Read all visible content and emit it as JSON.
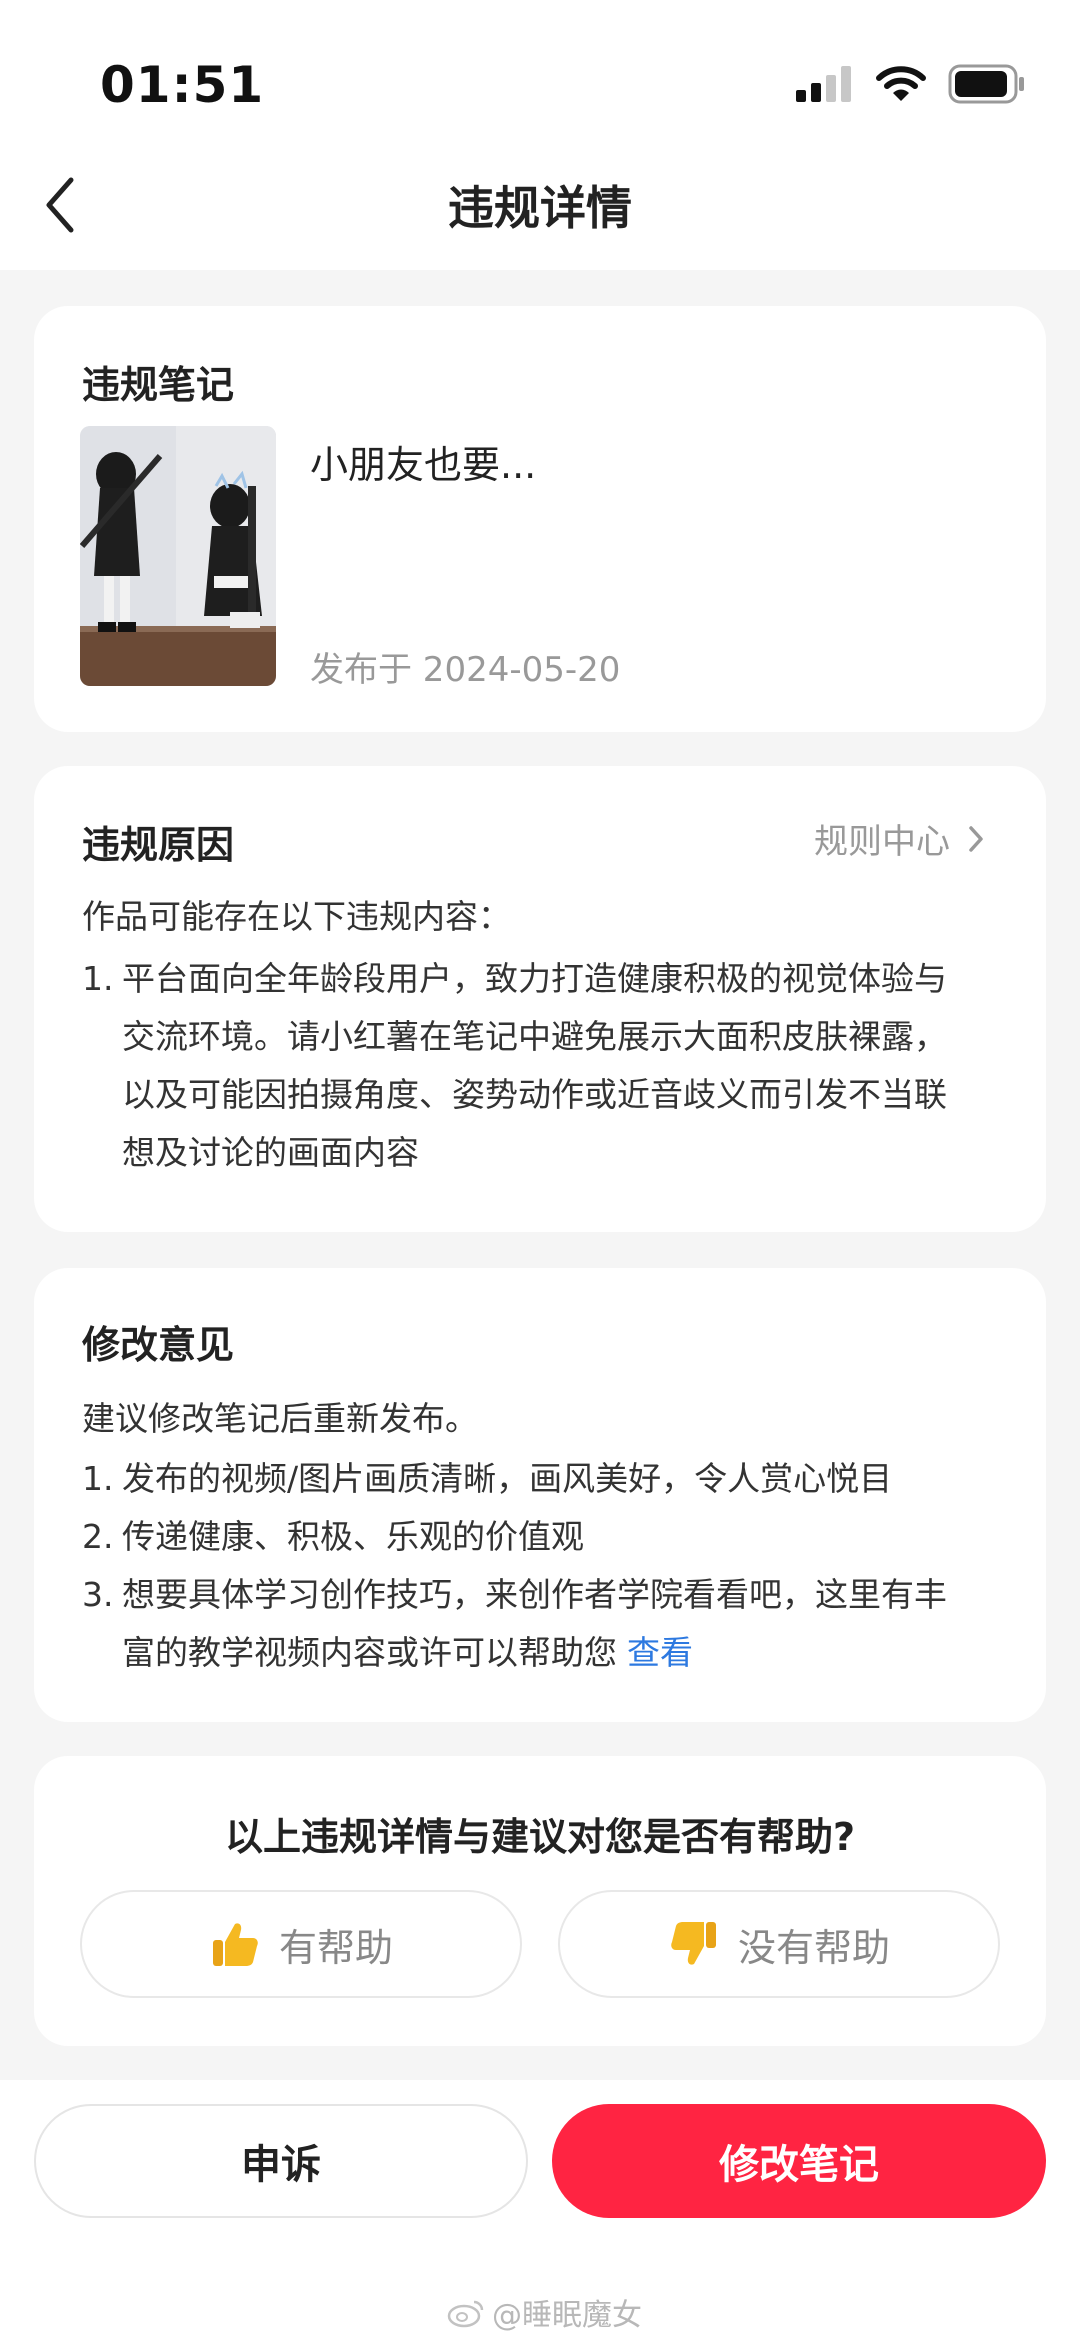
{
  "status_bar": {
    "time": "01:51"
  },
  "nav": {
    "title": "违规详情"
  },
  "note_card": {
    "title": "违规笔记",
    "note_title": "小朋友也要...",
    "date": "发布于 2024-05-20"
  },
  "reason_card": {
    "title": "违规原因",
    "rule_link": "规则中心",
    "intro": "作品可能存在以下违规内容：",
    "items": [
      {
        "num": "1.",
        "lines": [
          "平台面向全年龄段用户，致力打造健康积极的视觉体验与",
          "交流环境。请小红薯在笔记中避免展示大面积皮肤裸露，",
          "以及可能因拍摄角度、姿势动作或近音歧义而引发不当联",
          "想及讨论的画面内容"
        ]
      }
    ]
  },
  "advice_card": {
    "title": "修改意见",
    "intro": "建议修改笔记后重新发布。",
    "items": [
      {
        "num": "1.",
        "text": "发布的视频/图片画质清晰，画风美好，令人赏心悦目"
      },
      {
        "num": "2.",
        "text": "传递健康、积极、乐观的价值观"
      },
      {
        "num": "3.",
        "line1": "想要具体学习创作技巧，来创作者学院看看吧，这里有丰",
        "line2": "富的教学视频内容或许可以帮助您",
        "link": "查看"
      }
    ]
  },
  "feedback_card": {
    "question": "以上违规详情与建议对您是否有帮助?",
    "helpful": "有帮助",
    "not_helpful": "没有帮助"
  },
  "bottom_bar": {
    "appeal": "申诉",
    "edit": "修改笔记"
  },
  "watermark": "@睡眠魔女",
  "colors": {
    "accent": "#ff2442",
    "link": "#2d79e0",
    "thumb_up": "#f5b921"
  },
  "icons": [
    "back-arrow-icon",
    "signal-icon",
    "wifi-icon",
    "battery-icon",
    "chevron-right-icon",
    "thumbs-up-icon",
    "thumbs-down-icon",
    "weibo-icon"
  ]
}
